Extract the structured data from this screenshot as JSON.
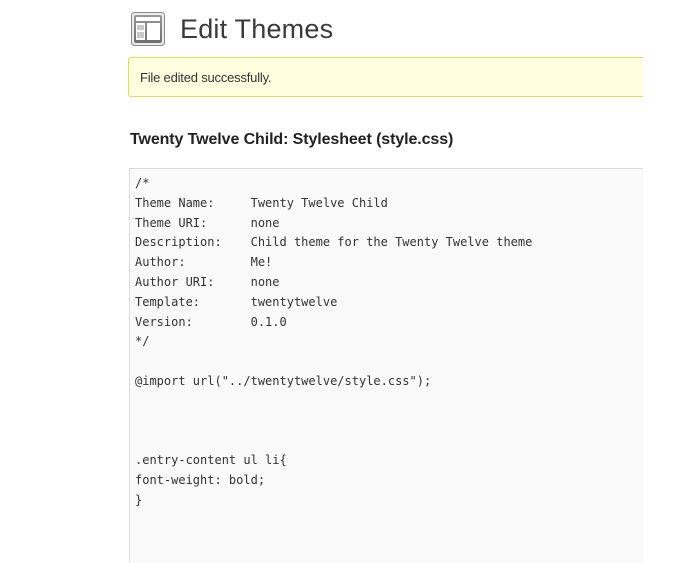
{
  "header": {
    "title": "Edit Themes",
    "icon": "appearance-icon"
  },
  "notice": {
    "message": "File edited successfully.",
    "colors": {
      "background": "#ffffe0",
      "border": "#e6db55"
    }
  },
  "file": {
    "theme_name": "Twenty Twelve Child: Stylesheet",
    "filename": "(style.css)"
  },
  "editor": {
    "content": "/*\nTheme Name:     Twenty Twelve Child\nTheme URI:      none\nDescription:    Child theme for the Twenty Twelve theme\nAuthor:         Me!\nAuthor URI:     none\nTemplate:       twentytwelve\nVersion:        0.1.0\n*/\n\n@import url(\"../twentytwelve/style.css\");\n\n\n\n.entry-content ul li{\nfont-weight: bold;\n}\n"
  }
}
